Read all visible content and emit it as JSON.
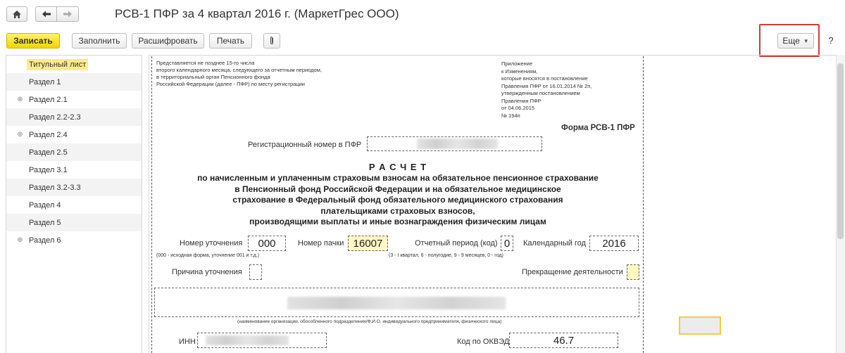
{
  "window": {
    "title": "РСВ-1 ПФР за 4 квартал 2016 г. (МаркетГрес ООО)",
    "home_icon": "home-icon",
    "back_icon": "arrow-left-icon",
    "forward_icon": "arrow-right-icon",
    "help_label": "?"
  },
  "toolbar": {
    "save_label": "Записать",
    "fill_label": "Заполнить",
    "decode_label": "Расшифровать",
    "print_label": "Печать",
    "attach_icon": "paperclip-icon",
    "more_label": "Еще"
  },
  "sidebar": {
    "items": [
      {
        "label": "Титульный лист",
        "expandable": false,
        "selected": true
      },
      {
        "label": "Раздел 1",
        "expandable": false
      },
      {
        "label": "Раздел 2.1",
        "expandable": true
      },
      {
        "label": "Раздел 2.2-2.3",
        "expandable": false
      },
      {
        "label": "Раздел 2.4",
        "expandable": true
      },
      {
        "label": "Раздел 2.5",
        "expandable": false
      },
      {
        "label": "Раздел 3.1",
        "expandable": false
      },
      {
        "label": "Раздел 3.2-3.3",
        "expandable": false
      },
      {
        "label": "Раздел 4",
        "expandable": false
      },
      {
        "label": "Раздел 5",
        "expandable": false
      },
      {
        "label": "Раздел 6",
        "expandable": true
      }
    ]
  },
  "form": {
    "left_note": [
      "Представляется не позднее 15-го числа",
      "второго календарного месяца, следующего за отчетным периодом,",
      "в территориальный орган Пенсионного фонда",
      "Российской Федерации (далее - ПФР) по месту регистрации"
    ],
    "right_note": [
      "Приложение",
      "к Изменениям,",
      "которые вносятся в постановление",
      "Правления ПФР от 16.01.2014 № 2п,",
      "утвержденным постановлением",
      "Правления ПФР",
      "от 04.06.2015",
      "№ 194п"
    ],
    "form_name": "Форма РСВ-1 ПФР",
    "reg_number_label": "Регистрационный номер в ПФР",
    "heading_title": "Р А С Ч Е Т",
    "heading_lines": [
      "по начисленным и уплаченным страховым взносам на обязательное пенсионное страхование",
      "в Пенсионный фонд Российской Федерации и на обязательное медицинское",
      "страхование в Федеральный фонд обязательного медицинского страхования",
      "плательщиками страховых взносов,",
      "производящими выплаты и иные вознаграждения физическим лицам"
    ],
    "correction_number_label": "Номер уточнения",
    "correction_number_value": "000",
    "correction_hint": "(000 - исходная форма, уточнение 001 и т.д.)",
    "pack_number_label": "Номер пачки",
    "pack_number_value": "16007",
    "period_label": "Отчетный период (код)",
    "period_value": "0",
    "period_hint": "(3 - I квартал, 6 - полугодие, 9 - 9 месяцев, 0 - год)",
    "year_label": "Календарный год",
    "year_value": "2016",
    "correction_reason_label": "Причина уточнения",
    "termination_label": "Прекращение деятельности",
    "org_hint": "(наименование организации, обособленного подразделения/Ф.И.О. индивидуального предпринимателя, физического лица)",
    "inn_label": "ИНН",
    "okved_label": "Код по ОКВЭД",
    "okved_value": "46.7"
  },
  "colors": {
    "primary_button": "#f5d800",
    "highlight_field": "#fff7c4",
    "selection": "#fbeb8a",
    "attention_frame": "#d43b3b"
  }
}
